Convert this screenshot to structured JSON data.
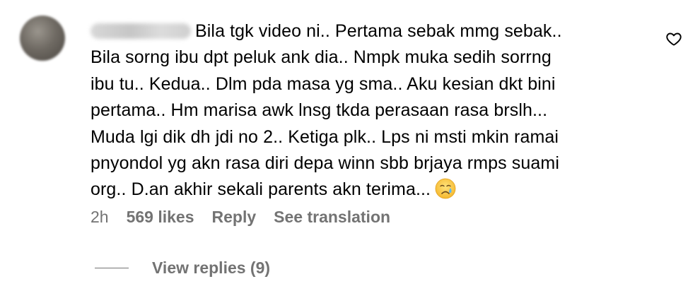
{
  "comment": {
    "lines": [
      "Bila tgk video ni.. Pertama sebak mmg sebak..",
      "Bila sorng ibu dpt peluk ank dia.. Nmpk muka sedih sorrng",
      "ibu tu.. Kedua.. Dlm pda masa yg sma.. Aku kesian dkt bini",
      "pertama.. Hm marisa awk lnsg tkda perasaan rasa brslh...",
      "Muda lgi dik dh jdi no 2.. Ketiga plk.. Lps ni msti mkin ramai",
      "pnyondol yg akn rasa diri depa winn sbb brjaya rmps suami",
      "org.. D.an akhir sekali parents akn terima..."
    ],
    "emoji": "crying-face-emoji"
  },
  "meta": {
    "time": "2h",
    "likes": "569 likes",
    "reply_label": "Reply",
    "translate_label": "See translation"
  },
  "replies": {
    "view_label": "View replies (9)"
  },
  "icons": {
    "like": "heart-outline-icon"
  },
  "colors": {
    "text": "#000000",
    "secondary": "#737373",
    "background": "#ffffff"
  }
}
